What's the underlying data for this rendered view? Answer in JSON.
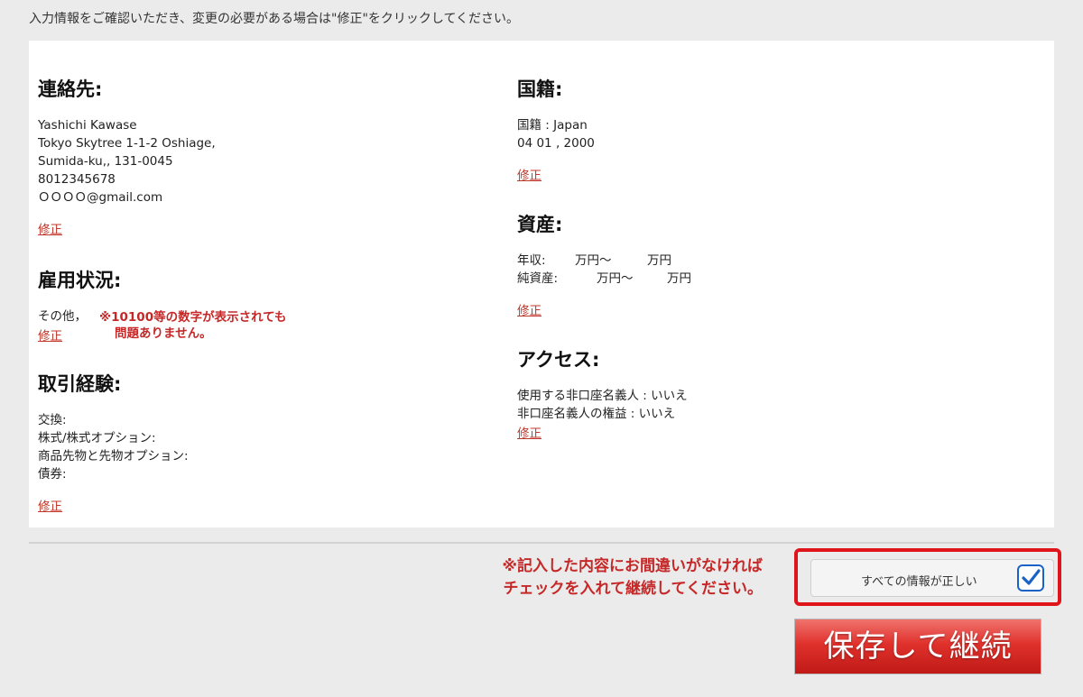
{
  "instruction": "入力情報をご確認いただき、変更の必要がある場合は\"修正\"をクリックしてください。",
  "edit_label": "修正",
  "contact": {
    "heading": "連絡先:",
    "lines": [
      "Yashichi Kawase",
      "Tokyo Skytree 1-1-2 Oshiage,",
      "Sumida-ku,, 131-0045",
      "8012345678",
      "ＯＯＯＯ@gmail.com"
    ]
  },
  "employment": {
    "heading": "雇用状況:",
    "value": "その他，",
    "note_lines": [
      "※10100等の数字が表示されても",
      "問題ありません。"
    ]
  },
  "experience": {
    "heading": "取引経験:",
    "lines": [
      "交換:",
      "株式/株式オプション:",
      "商品先物と先物オプション:",
      "債券:"
    ]
  },
  "nationality": {
    "heading": "国籍:",
    "lines": [
      "国籍 : Japan",
      "04 01 , 2000"
    ]
  },
  "assets": {
    "heading": "資産:",
    "income": {
      "label": "年収:",
      "from": "万円〜",
      "to": "万円"
    },
    "net": {
      "label": "純資産:",
      "from": "万円〜",
      "to": "万円"
    }
  },
  "access": {
    "heading": "アクセス:",
    "lines": [
      "使用する非口座名義人 : いいえ",
      "非口座名義人の権益 : いいえ"
    ]
  },
  "bottom_note": [
    "※記入した内容にお間違いがなければ",
    "チェックを入れて継続してください。"
  ],
  "confirm": {
    "label": "すべての情報が正しい",
    "checked": true,
    "accent": "#1a62c8",
    "highlight": "#e0141b"
  },
  "save_button": "保存して継続",
  "colors": {
    "edit_link": "#c0392b",
    "note": "#c62828",
    "button": "#e0312c"
  }
}
